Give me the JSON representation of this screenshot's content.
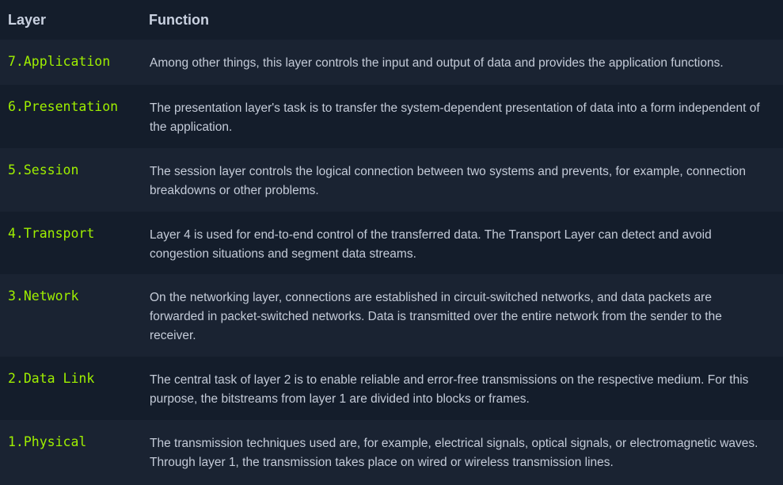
{
  "table": {
    "headers": {
      "layer": "Layer",
      "function": "Function"
    },
    "rows": [
      {
        "layer": "7.Application",
        "function": "Among other things, this layer controls the input and output of data and provides the application functions."
      },
      {
        "layer": "6.Presentation",
        "function": "The presentation layer's task is to transfer the system-dependent presentation of data into a form independent of the application."
      },
      {
        "layer": "5.Session",
        "function": "The session layer controls the logical connection between two systems and prevents, for example, connection breakdowns or other problems."
      },
      {
        "layer": "4.Transport",
        "function": "Layer 4 is used for end-to-end control of the transferred data. The Transport Layer can detect and avoid congestion situations and segment data streams."
      },
      {
        "layer": "3.Network",
        "function": "On the networking layer, connections are established in circuit-switched networks, and data packets are forwarded in packet-switched networks. Data is transmitted over the entire network from the sender to the receiver."
      },
      {
        "layer": "2.Data Link",
        "function": "The central task of layer 2 is to enable reliable and error-free transmissions on the respective medium. For this purpose, the bitstreams from layer 1 are divided into blocks or frames."
      },
      {
        "layer": "1.Physical",
        "function": "The transmission techniques used are, for example, electrical signals, optical signals, or electromagnetic waves. Through layer 1, the transmission takes place on wired or wireless transmission lines."
      }
    ]
  },
  "colors": {
    "background": "#141d2b",
    "row_alt": "#1a2332",
    "layer_text": "#9fef00",
    "body_text": "#c4cbd8",
    "header_text": "#c9d1e0"
  }
}
